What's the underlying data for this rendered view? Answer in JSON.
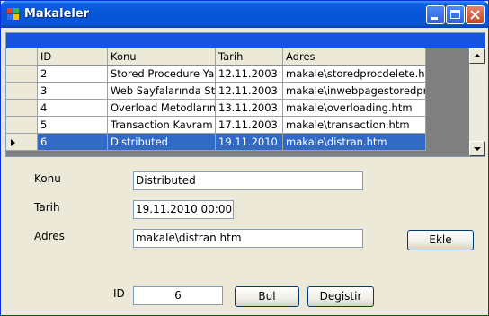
{
  "window": {
    "title": "Makaleler"
  },
  "grid": {
    "columns": [
      "ID",
      "Konu",
      "Tarih",
      "Adres"
    ],
    "rows": [
      {
        "id": "2",
        "konu": "Stored Procedure Ya",
        "tarih": "12.11.2003",
        "adres": "makale\\storedprocdelete.ht"
      },
      {
        "id": "3",
        "konu": "Web Sayfalarında St",
        "tarih": "12.11.2003",
        "adres": "makale\\inwebpagestoredpro"
      },
      {
        "id": "4",
        "konu": "Overload Metodların",
        "tarih": "13.11.2003",
        "adres": "makale\\overloading.htm"
      },
      {
        "id": "5",
        "konu": "Transaction Kavram",
        "tarih": "17.11.2003",
        "adres": "makale\\transaction.htm"
      },
      {
        "id": "6",
        "konu": "Distributed",
        "tarih": "19.11.2010",
        "adres": "makale\\distran.htm"
      }
    ],
    "selected_row_index": 4
  },
  "form": {
    "konu_label": "Konu",
    "konu_value": "Distributed",
    "tarih_label": "Tarih",
    "tarih_value": "19.11.2010 00:00:0",
    "adres_label": "Adres",
    "adres_value": "makale\\distran.htm",
    "ekle_button": "Ekle",
    "id_label": "ID",
    "id_value": "6",
    "bul_button": "Bul",
    "degistir_button": "Degistir"
  },
  "colors": {
    "titlebar": "#0753d6",
    "selection": "#316ac5",
    "grid_caption": "#1653de",
    "window_bg": "#ece9d8"
  },
  "icons": [
    "app-window-icon",
    "minimize-icon",
    "maximize-icon",
    "close-icon",
    "current-row-arrow-icon",
    "scroll-up-arrow-icon",
    "scroll-down-arrow-icon"
  ]
}
